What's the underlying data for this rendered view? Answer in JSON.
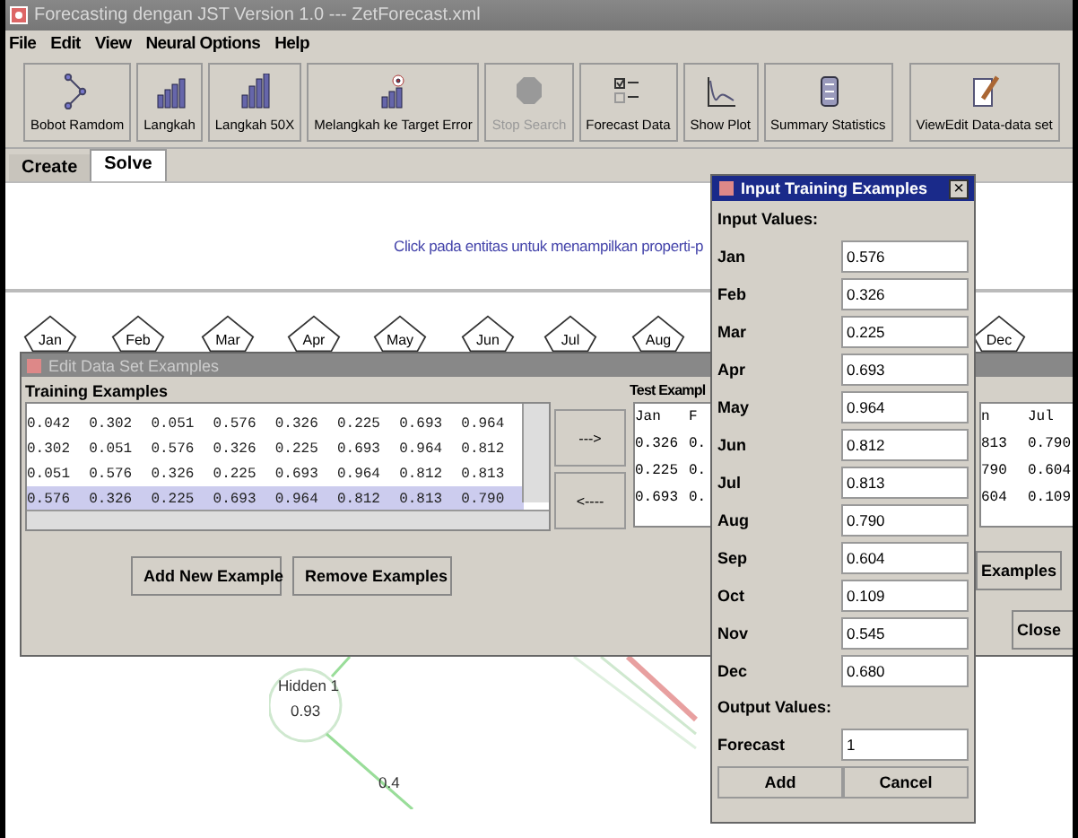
{
  "window": {
    "title": "Forecasting dengan JST Version 1.0 --- ZetForecast.xml"
  },
  "menu": [
    "File",
    "Edit",
    "View",
    "Neural Options",
    "Help"
  ],
  "toolbar": [
    {
      "label": "Bobot Ramdom",
      "kind": "graph",
      "disabled": false
    },
    {
      "label": "Langkah",
      "kind": "bars",
      "disabled": false
    },
    {
      "label": "Langkah 50X",
      "kind": "bars-tall",
      "disabled": false
    },
    {
      "label": "Melangkah ke Target Error",
      "kind": "target",
      "disabled": false
    },
    {
      "label": "Stop Search",
      "kind": "stop",
      "disabled": true
    },
    {
      "label": "Forecast Data",
      "kind": "checklist",
      "disabled": false
    },
    {
      "label": "Show Plot",
      "kind": "plot",
      "disabled": false
    },
    {
      "label": "Summary Statistics",
      "kind": "notebook",
      "disabled": false
    },
    {
      "label": "ViewEdit Data-data set",
      "kind": "edit",
      "disabled": false
    }
  ],
  "tabs": [
    {
      "label": "Create",
      "selected": false
    },
    {
      "label": "Solve",
      "selected": true
    }
  ],
  "hint": "Click pada entitas untuk menampilkan properti-p",
  "input_nodes": [
    "Jan",
    "Feb",
    "Mar",
    "Apr",
    "May",
    "Jun",
    "Jul",
    "Aug",
    "Dec"
  ],
  "network": {
    "hidden_label": "Hidden 1",
    "hidden_value": "0.93",
    "weight": "0.4"
  },
  "edit_dialog": {
    "title": "Edit Data Set Examples",
    "training_label": "Training Examples",
    "training_rows": [
      {
        "cells": [
          "0.042",
          "0.302",
          "0.051",
          "0.576",
          "0.326",
          "0.225",
          "0.693",
          "0.964"
        ],
        "selected": false
      },
      {
        "cells": [
          "0.302",
          "0.051",
          "0.576",
          "0.326",
          "0.225",
          "0.693",
          "0.964",
          "0.812"
        ],
        "selected": false
      },
      {
        "cells": [
          "0.051",
          "0.576",
          "0.326",
          "0.225",
          "0.693",
          "0.964",
          "0.812",
          "0.813"
        ],
        "selected": false
      },
      {
        "cells": [
          "0.576",
          "0.326",
          "0.225",
          "0.693",
          "0.964",
          "0.812",
          "0.813",
          "0.790"
        ],
        "selected": true
      }
    ],
    "move_right": "--->",
    "move_left": "<----",
    "test_label": "Test Exampl",
    "test_left_header": [
      "Jan",
      "F"
    ],
    "test_left_rows": [
      [
        "0.326",
        "0."
      ],
      [
        "0.225",
        "0."
      ],
      [
        "0.693",
        "0."
      ]
    ],
    "test_right_header": [
      "n",
      "Jul"
    ],
    "test_right_rows": [
      [
        "813",
        "0.790"
      ],
      [
        "790",
        "0.604"
      ],
      [
        "604",
        "0.109"
      ]
    ],
    "add_button": "Add New Example",
    "remove_button": "Remove Examples",
    "examples_button": "Examples",
    "close_button": "Close"
  },
  "input_dialog": {
    "title": "Input Training Examples",
    "close": "×",
    "input_label": "Input Values:",
    "inputs": [
      {
        "label": "Jan",
        "value": "0.576"
      },
      {
        "label": "Feb",
        "value": "0.326"
      },
      {
        "label": "Mar",
        "value": "0.225"
      },
      {
        "label": "Apr",
        "value": "0.693"
      },
      {
        "label": "May",
        "value": "0.964"
      },
      {
        "label": "Jun",
        "value": "0.812"
      },
      {
        "label": "Jul",
        "value": "0.813"
      },
      {
        "label": "Aug",
        "value": "0.790"
      },
      {
        "label": "Sep",
        "value": "0.604"
      },
      {
        "label": "Oct",
        "value": "0.109"
      },
      {
        "label": "Nov",
        "value": "0.545"
      },
      {
        "label": "Dec",
        "value": "0.680"
      }
    ],
    "output_label": "Output Values:",
    "outputs": [
      {
        "label": "Forecast",
        "value": "1"
      }
    ],
    "buttons": [
      "Add",
      "Cancel"
    ]
  }
}
